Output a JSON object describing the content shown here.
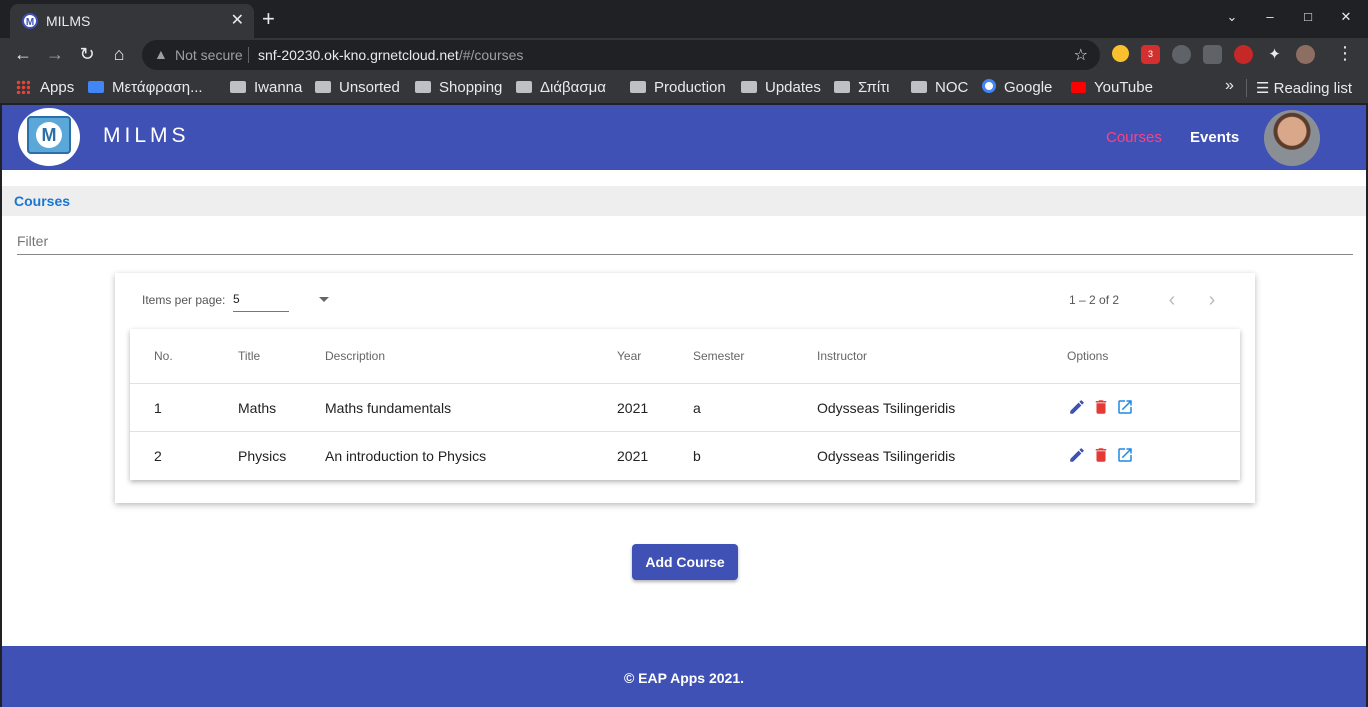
{
  "browser": {
    "tab_title": "MILMS",
    "tab_favicon_letter": "M",
    "security_label": "Not secure",
    "url_host": "snf-20230.ok-kno.grnetcloud.net",
    "url_path": "/#/courses",
    "bookmarks": [
      {
        "label": "Apps",
        "icon": "apps-grid-icon"
      },
      {
        "label": "Μετάφραση...",
        "icon": "google-translate-icon"
      },
      {
        "label": "Iwanna",
        "icon": "folder-icon"
      },
      {
        "label": "Unsorted",
        "icon": "folder-icon"
      },
      {
        "label": "Shopping",
        "icon": "folder-icon"
      },
      {
        "label": "Διάβασμα",
        "icon": "folder-icon"
      },
      {
        "label": "Production",
        "icon": "folder-icon"
      },
      {
        "label": "Updates",
        "icon": "folder-icon"
      },
      {
        "label": "Σπίτι",
        "icon": "folder-icon"
      },
      {
        "label": "NOC",
        "icon": "folder-icon"
      },
      {
        "label": "Google",
        "icon": "google-icon"
      },
      {
        "label": "YouTube",
        "icon": "youtube-icon"
      }
    ],
    "reading_list_label": "Reading list",
    "extension_badge_count": "3"
  },
  "header": {
    "brand": "MILMS",
    "logo_letter": "M",
    "nav": {
      "courses": "Courses",
      "events": "Events"
    }
  },
  "breadcrumb": {
    "current": "Courses"
  },
  "filter": {
    "placeholder": "Filter",
    "value": ""
  },
  "paginator": {
    "items_per_page_label": "Items per page:",
    "items_per_page_value": "5",
    "range_label": "1 – 2 of 2"
  },
  "table": {
    "columns": {
      "no": "No.",
      "title": "Title",
      "description": "Description",
      "year": "Year",
      "semester": "Semester",
      "instructor": "Instructor",
      "options": "Options"
    },
    "rows": [
      {
        "no": "1",
        "title": "Maths",
        "description": "Maths fundamentals",
        "year": "2021",
        "semester": "a",
        "instructor": "Odysseas Tsilingeridis"
      },
      {
        "no": "2",
        "title": "Physics",
        "description": "An introduction to Physics",
        "year": "2021",
        "semester": "b",
        "instructor": "Odysseas Tsilingeridis"
      }
    ]
  },
  "actions": {
    "add_course": "Add Course"
  },
  "footer": {
    "text": "© EAP Apps 2021."
  },
  "colors": {
    "primary": "#3f51b5",
    "accent": "#ff4081",
    "link": "#1976d2",
    "delete": "#e53935",
    "open": "#1e88e5"
  }
}
